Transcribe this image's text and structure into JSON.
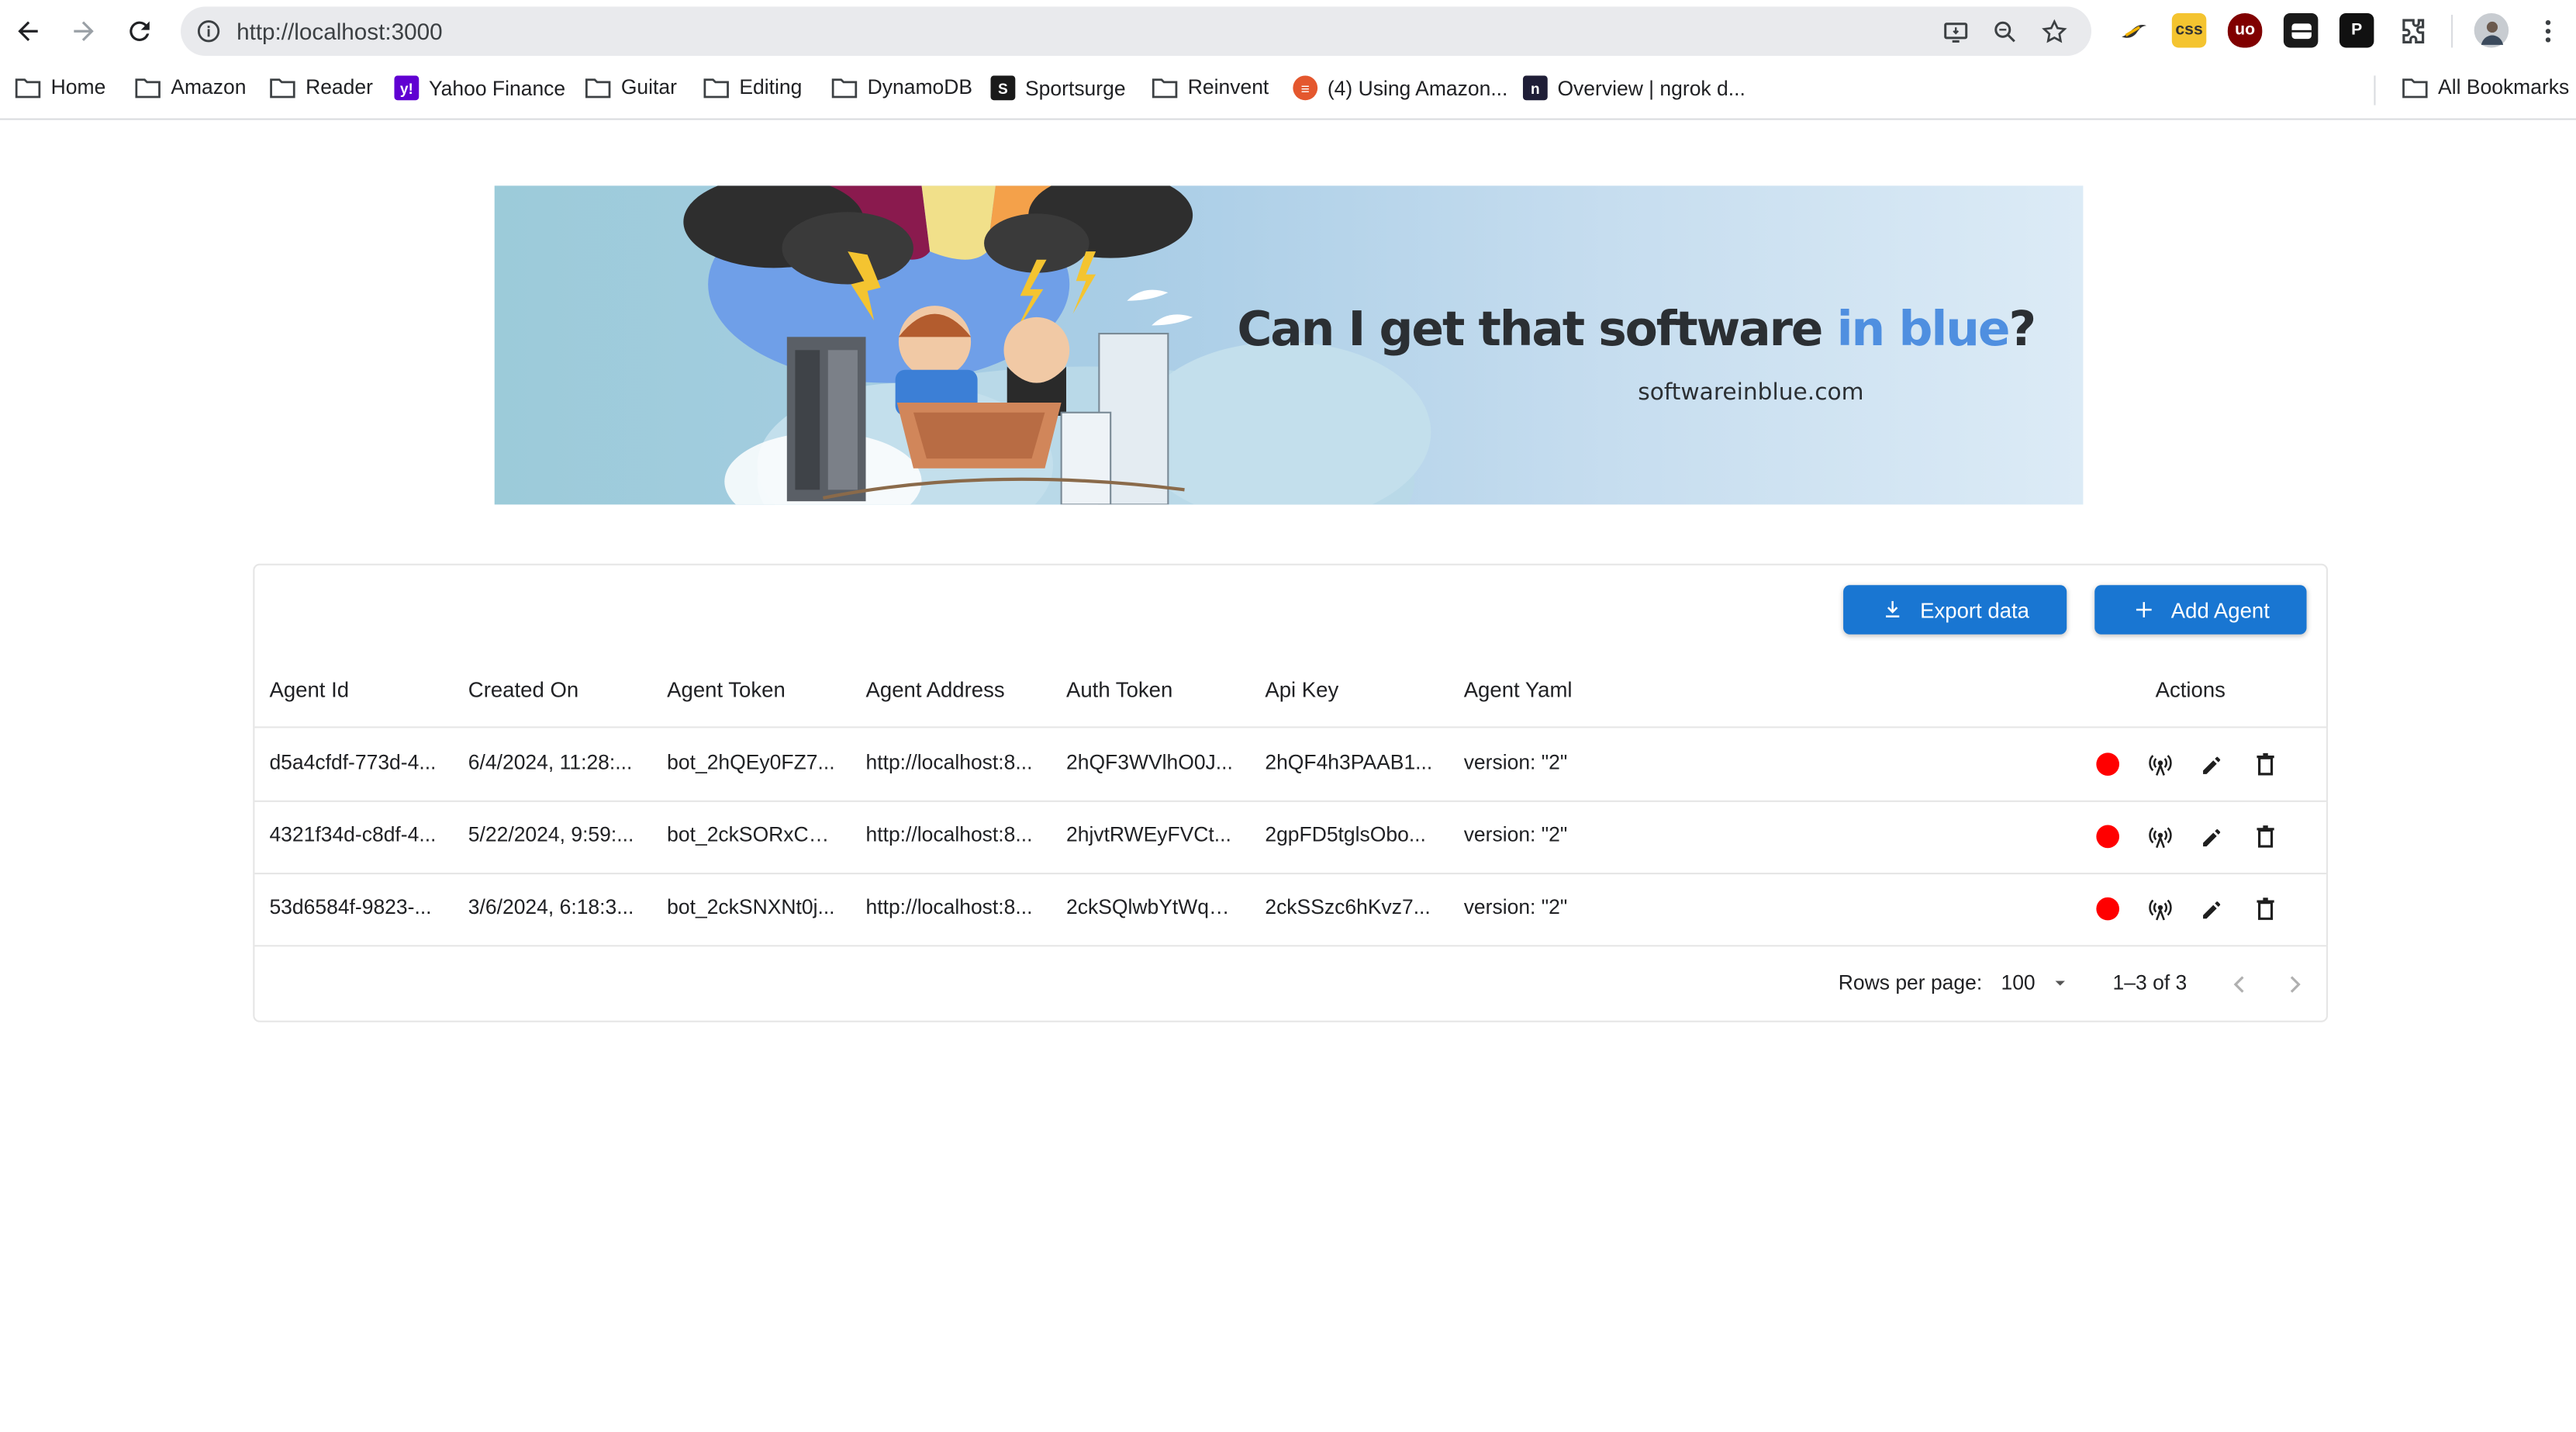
{
  "browser": {
    "url": "http://localhost:3000",
    "bookmarks": [
      {
        "label": "Home",
        "icon": "folder-icon"
      },
      {
        "label": "Amazon",
        "icon": "folder-icon"
      },
      {
        "label": "Reader",
        "icon": "folder-icon"
      },
      {
        "label": "Yahoo Finance",
        "icon": "yahoo-icon"
      },
      {
        "label": "Guitar",
        "icon": "folder-icon"
      },
      {
        "label": "Editing",
        "icon": "folder-icon"
      },
      {
        "label": "DynamoDB",
        "icon": "folder-icon"
      },
      {
        "label": "Sportsurge",
        "icon": "sportsurge-icon"
      },
      {
        "label": "Reinvent",
        "icon": "folder-icon"
      },
      {
        "label": "(4) Using Amazon...",
        "icon": "stackoverflow-icon"
      },
      {
        "label": "Overview | ngrok d...",
        "icon": "ngrok-icon"
      }
    ],
    "all_bookmarks": "All Bookmarks"
  },
  "banner": {
    "title_main": "Can I get that software ",
    "title_accent": "in blue",
    "title_end": "?",
    "subtitle": "softwareinblue.com"
  },
  "toolbar": {
    "export_label": "Export data",
    "add_label": "Add Agent"
  },
  "table": {
    "columns": [
      "Agent Id",
      "Created On",
      "Agent Token",
      "Agent Address",
      "Auth Token",
      "Api Key",
      "Agent Yaml",
      "Actions"
    ],
    "rows": [
      [
        "d5a4cfdf-773d-4...",
        "6/4/2024, 11:28:...",
        "bot_2hQEy0FZ7...",
        "http://localhost:8...",
        "2hQF3WVlhO0J...",
        "2hQF4h3PAAB1...",
        "version: \"2\""
      ],
      [
        "4321f34d-c8df-4...",
        "5/22/2024, 9:59:...",
        "bot_2ckSORxCw...",
        "http://localhost:8...",
        "2hjvtRWEyFVCt...",
        "2gpFD5tglsObo...",
        "version: \"2\""
      ],
      [
        "53d6584f-9823-...",
        "3/6/2024, 6:18:3...",
        "bot_2ckSNXNt0j...",
        "http://localhost:8...",
        "2ckSQlwbYtWq2...",
        "2ckSSzc6hKvz7...",
        "version: \"2\""
      ]
    ],
    "status_color": "#ff0000"
  },
  "pagination": {
    "rows_per_page_label": "Rows per page:",
    "rows_per_page_value": "100",
    "range": "1–3 of 3"
  },
  "colors": {
    "primary": "#1976d2",
    "status_dot": "#ff0000"
  }
}
